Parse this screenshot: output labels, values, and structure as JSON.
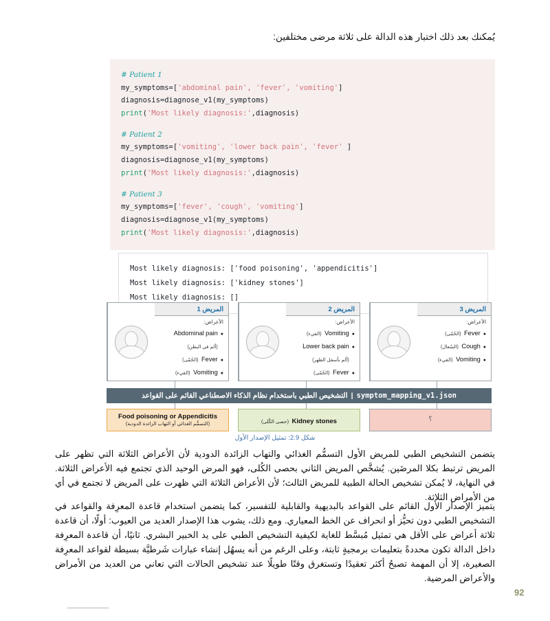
{
  "intro": {
    "text": "يُمكنك بعد ذلك اختبار هذه الدالة على ثلاثة مرضى مختلفين:"
  },
  "code": {
    "patient1": {
      "comment": "# Patient 1",
      "line1_pre": "my_symptoms=[",
      "line1_str": "'abdominal pain', 'fever', 'vomiting'",
      "line1_post": "]",
      "line2": "diagnosis=diagnose_v1(my_symptoms)",
      "line3_fn": "print",
      "line3_open": "(",
      "line3_str": "'Most likely diagnosis:'",
      "line3_post": ",diagnosis)"
    },
    "patient2": {
      "comment": "# Patient 2",
      "line1_pre": "my_symptoms=[",
      "line1_str": "'vomiting', 'lower back pain', 'fever'",
      "line1_post": " ]",
      "line2": "diagnosis=diagnose_v1(my_symptoms)",
      "line3_fn": "print",
      "line3_open": "(",
      "line3_str": "'Most likely diagnosis:'",
      "line3_post": ",diagnosis)"
    },
    "patient3": {
      "comment": "# Patient 3",
      "line1_pre": "my_symptoms=[",
      "line1_str": "'fever', 'cough', 'vomiting'",
      "line1_post": "]",
      "line2": "diagnosis=diagnose_v1(my_symptoms)",
      "line3_fn": "print",
      "line3_open": "(",
      "line3_str": "'Most likely diagnosis:'",
      "line3_post": ",diagnosis)"
    }
  },
  "output": {
    "line1": "Most likely diagnosis: ['food poisoning', 'appendicitis']",
    "line2": "Most likely diagnosis: ['kidney stones']",
    "line3": "Most likely diagnosis: []"
  },
  "diagram": {
    "patients": [
      {
        "header": "المريض 1",
        "symptoms_label": "الأعراض:",
        "symptoms": [
          {
            "en": "Abdominal pain",
            "ar": "(ألم في البطن)"
          },
          {
            "en": "Fever",
            "ar": "(الحُمّى)"
          },
          {
            "en": "Vomiting",
            "ar": "(القيء)"
          }
        ]
      },
      {
        "header": "المريض 2",
        "symptoms_label": "الأعراض:",
        "symptoms": [
          {
            "en": "Vomiting",
            "ar": "(القيء)"
          },
          {
            "en": "Lower back pain",
            "ar": "(ألم بأسفل الظهر)"
          },
          {
            "en": "Fever",
            "ar": "(الحُمّى)"
          }
        ]
      },
      {
        "header": "المريض 3",
        "symptoms_label": "الأعراض:",
        "symptoms": [
          {
            "en": "Fever",
            "ar": "(الحُمّى)"
          },
          {
            "en": "Cough",
            "ar": "(السُعال)"
          },
          {
            "en": "Vomiting",
            "ar": "(القيء)"
          }
        ]
      }
    ],
    "rule_bar": {
      "arabic": "التشخيص الطبي باستخدام نظام الذكاء الاصطناعي القائم على القواعد",
      "separator": "|",
      "file": "symptom_mapping_v1.json"
    },
    "results": [
      {
        "en": "Food poisoning or Appendicitis",
        "ar": "(التسمُّم الغذائي أو التهاب الزائدة الدودية)",
        "style": "orange"
      },
      {
        "en": "Kidney stones",
        "ar": "(حصى الكُلى)",
        "style": "green"
      },
      {
        "en": "؟",
        "ar": "",
        "style": "pink"
      }
    ],
    "caption": "شكل 2.9: تمثيل الإصدار الأول"
  },
  "paragraphs": {
    "p1": "يتضمن التشخيص الطبي للمريض الأول التسمُّم الغذائي والتهاب الزائدة الدودية لأن الأعراض الثلاثة التي تظهر على المريض ترتبط بكلا المرضَين. يُشخَّص المريض الثاني بحصى الكُلى، فهو المرض الوحيد الذي تجتمع فيه الأعراض الثلاثة. في النهاية، لا يُمكن تشخيص الحالة الطبية للمريض الثالث؛ لأن الأعراض الثلاثة التي ظهرت على المريض لا تجتمع في أي من الأمراض الثلاثة.",
    "p2": "يتميز الإصدار الأول القائم على القواعد بالبديهية والقابلية للتفسير، كما يتضمن استخدام قاعدة المعرِفة والقواعد في التشخيص الطبي دون تحيُّز أو انحراف عن الخط المعياري. ومع ذلك، يشوب هذا الإصدار العديد من العيوب: أولًا، أن قاعدة ثلاثة أعراض على الأقل هي تمثيل مُبسَّط للغاية لكيفية التشخيص الطبي على يد الخبير البشري. ثانيًا، أن قاعدة المعرِفة داخل الدالة تكون محددةً بتعليمات برمجيةٍ ثابتة، وعلى الرغم من أنه يسهُل إنشاء عبارات شَرطيَّة بسيطة لقواعد المعرِفة الصغيرة، إلا أن المهمة تصبحُ أكثر تعقيدًا وتستغرق وقتًا طويلًا عند تشخيص الحالات التي تعاني من العديد من الأمراض والأعراض المرضية."
  },
  "page_number": "92"
}
